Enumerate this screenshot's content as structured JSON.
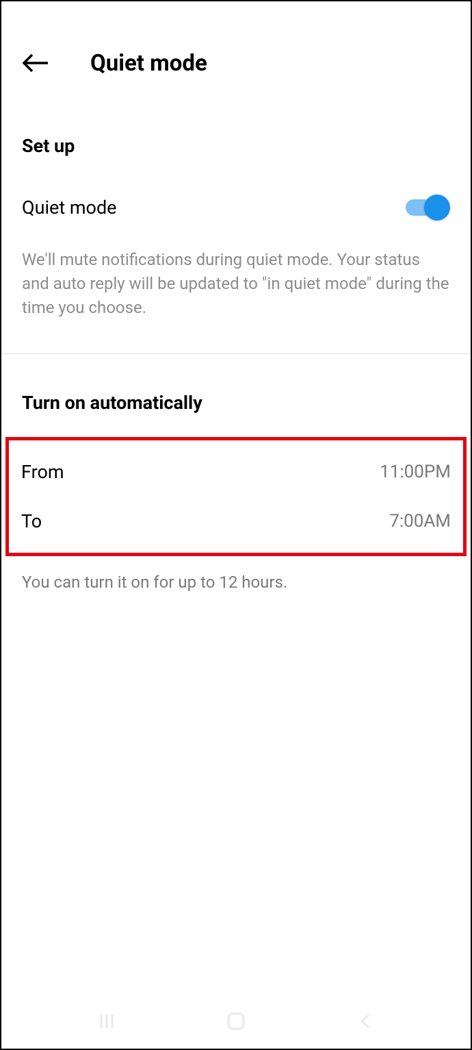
{
  "header": {
    "title": "Quiet mode"
  },
  "setup": {
    "heading": "Set up",
    "toggle_label": "Quiet mode",
    "toggle_on": true,
    "description": "We'll mute notifications during quiet mode. Your status and auto reply will be updated to \"in quiet mode\" during the time you choose."
  },
  "schedule": {
    "heading": "Turn on automatically",
    "from_label": "From",
    "from_value": "11:00PM",
    "to_label": "To",
    "to_value": "7:00AM",
    "hint": "You can turn it on for up to 12 hours."
  }
}
